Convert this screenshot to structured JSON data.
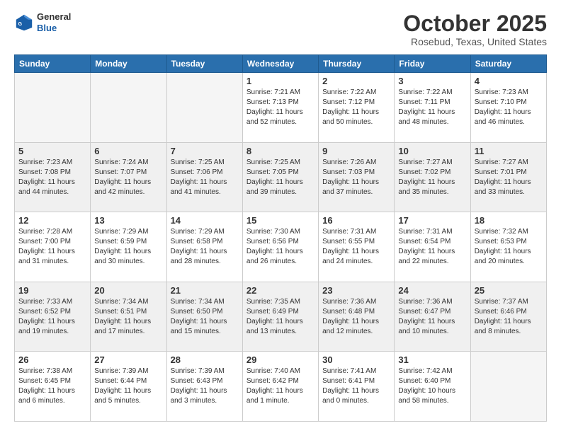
{
  "header": {
    "logo_general": "General",
    "logo_blue": "Blue",
    "month": "October 2025",
    "location": "Rosebud, Texas, United States"
  },
  "weekdays": [
    "Sunday",
    "Monday",
    "Tuesday",
    "Wednesday",
    "Thursday",
    "Friday",
    "Saturday"
  ],
  "weeks": [
    [
      {
        "day": "",
        "info": ""
      },
      {
        "day": "",
        "info": ""
      },
      {
        "day": "",
        "info": ""
      },
      {
        "day": "1",
        "info": "Sunrise: 7:21 AM\nSunset: 7:13 PM\nDaylight: 11 hours\nand 52 minutes."
      },
      {
        "day": "2",
        "info": "Sunrise: 7:22 AM\nSunset: 7:12 PM\nDaylight: 11 hours\nand 50 minutes."
      },
      {
        "day": "3",
        "info": "Sunrise: 7:22 AM\nSunset: 7:11 PM\nDaylight: 11 hours\nand 48 minutes."
      },
      {
        "day": "4",
        "info": "Sunrise: 7:23 AM\nSunset: 7:10 PM\nDaylight: 11 hours\nand 46 minutes."
      }
    ],
    [
      {
        "day": "5",
        "info": "Sunrise: 7:23 AM\nSunset: 7:08 PM\nDaylight: 11 hours\nand 44 minutes."
      },
      {
        "day": "6",
        "info": "Sunrise: 7:24 AM\nSunset: 7:07 PM\nDaylight: 11 hours\nand 42 minutes."
      },
      {
        "day": "7",
        "info": "Sunrise: 7:25 AM\nSunset: 7:06 PM\nDaylight: 11 hours\nand 41 minutes."
      },
      {
        "day": "8",
        "info": "Sunrise: 7:25 AM\nSunset: 7:05 PM\nDaylight: 11 hours\nand 39 minutes."
      },
      {
        "day": "9",
        "info": "Sunrise: 7:26 AM\nSunset: 7:03 PM\nDaylight: 11 hours\nand 37 minutes."
      },
      {
        "day": "10",
        "info": "Sunrise: 7:27 AM\nSunset: 7:02 PM\nDaylight: 11 hours\nand 35 minutes."
      },
      {
        "day": "11",
        "info": "Sunrise: 7:27 AM\nSunset: 7:01 PM\nDaylight: 11 hours\nand 33 minutes."
      }
    ],
    [
      {
        "day": "12",
        "info": "Sunrise: 7:28 AM\nSunset: 7:00 PM\nDaylight: 11 hours\nand 31 minutes."
      },
      {
        "day": "13",
        "info": "Sunrise: 7:29 AM\nSunset: 6:59 PM\nDaylight: 11 hours\nand 30 minutes."
      },
      {
        "day": "14",
        "info": "Sunrise: 7:29 AM\nSunset: 6:58 PM\nDaylight: 11 hours\nand 28 minutes."
      },
      {
        "day": "15",
        "info": "Sunrise: 7:30 AM\nSunset: 6:56 PM\nDaylight: 11 hours\nand 26 minutes."
      },
      {
        "day": "16",
        "info": "Sunrise: 7:31 AM\nSunset: 6:55 PM\nDaylight: 11 hours\nand 24 minutes."
      },
      {
        "day": "17",
        "info": "Sunrise: 7:31 AM\nSunset: 6:54 PM\nDaylight: 11 hours\nand 22 minutes."
      },
      {
        "day": "18",
        "info": "Sunrise: 7:32 AM\nSunset: 6:53 PM\nDaylight: 11 hours\nand 20 minutes."
      }
    ],
    [
      {
        "day": "19",
        "info": "Sunrise: 7:33 AM\nSunset: 6:52 PM\nDaylight: 11 hours\nand 19 minutes."
      },
      {
        "day": "20",
        "info": "Sunrise: 7:34 AM\nSunset: 6:51 PM\nDaylight: 11 hours\nand 17 minutes."
      },
      {
        "day": "21",
        "info": "Sunrise: 7:34 AM\nSunset: 6:50 PM\nDaylight: 11 hours\nand 15 minutes."
      },
      {
        "day": "22",
        "info": "Sunrise: 7:35 AM\nSunset: 6:49 PM\nDaylight: 11 hours\nand 13 minutes."
      },
      {
        "day": "23",
        "info": "Sunrise: 7:36 AM\nSunset: 6:48 PM\nDaylight: 11 hours\nand 12 minutes."
      },
      {
        "day": "24",
        "info": "Sunrise: 7:36 AM\nSunset: 6:47 PM\nDaylight: 11 hours\nand 10 minutes."
      },
      {
        "day": "25",
        "info": "Sunrise: 7:37 AM\nSunset: 6:46 PM\nDaylight: 11 hours\nand 8 minutes."
      }
    ],
    [
      {
        "day": "26",
        "info": "Sunrise: 7:38 AM\nSunset: 6:45 PM\nDaylight: 11 hours\nand 6 minutes."
      },
      {
        "day": "27",
        "info": "Sunrise: 7:39 AM\nSunset: 6:44 PM\nDaylight: 11 hours\nand 5 minutes."
      },
      {
        "day": "28",
        "info": "Sunrise: 7:39 AM\nSunset: 6:43 PM\nDaylight: 11 hours\nand 3 minutes."
      },
      {
        "day": "29",
        "info": "Sunrise: 7:40 AM\nSunset: 6:42 PM\nDaylight: 11 hours\nand 1 minute."
      },
      {
        "day": "30",
        "info": "Sunrise: 7:41 AM\nSunset: 6:41 PM\nDaylight: 11 hours\nand 0 minutes."
      },
      {
        "day": "31",
        "info": "Sunrise: 7:42 AM\nSunset: 6:40 PM\nDaylight: 10 hours\nand 58 minutes."
      },
      {
        "day": "",
        "info": ""
      }
    ]
  ]
}
